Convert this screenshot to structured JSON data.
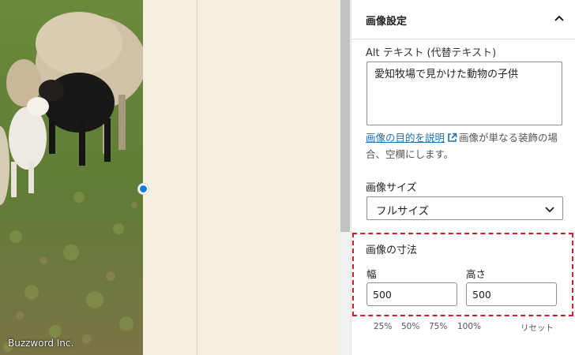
{
  "canvas": {
    "watermark": "Buzzword Inc."
  },
  "panel": {
    "title": "画像設定",
    "alt": {
      "label": "Alt テキスト (代替テキスト)",
      "value": "愛知牧場で見かけた動物の子供",
      "help_link": "画像の目的を説明",
      "help_rest": "画像が単なる装飾の場合、空欄にします。"
    },
    "size": {
      "label": "画像サイズ",
      "value": "フルサイズ"
    },
    "dimensions": {
      "label": "画像の寸法",
      "width_label": "幅",
      "height_label": "高さ",
      "width_value": "500",
      "height_value": "500",
      "presets": [
        "25%",
        "50%",
        "75%",
        "100%"
      ],
      "reset_label": "リセット"
    }
  },
  "colors": {
    "accent": "#1a7bd6",
    "link": "#2271b1",
    "highlight": "#d11a2a",
    "canvas_bg": "#f5efe0"
  }
}
